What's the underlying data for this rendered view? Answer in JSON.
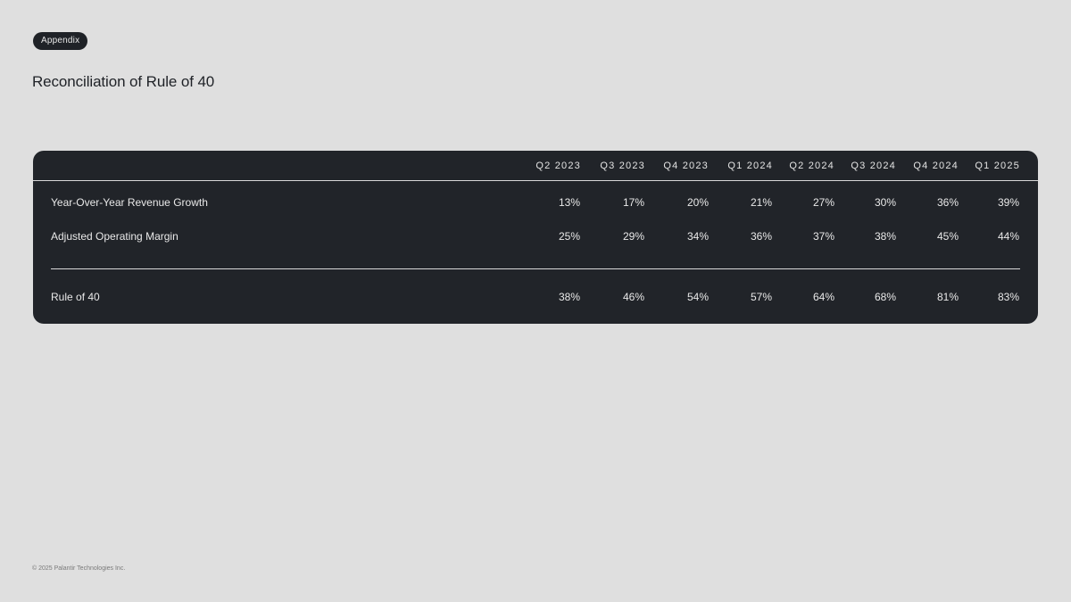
{
  "badge": "Appendix",
  "title": "Reconciliation of Rule of 40",
  "table": {
    "columns": [
      "Q2 2023",
      "Q3 2023",
      "Q4 2023",
      "Q1 2024",
      "Q2 2024",
      "Q3 2024",
      "Q4 2024",
      "Q1 2025"
    ],
    "rows": [
      {
        "label": "Year-Over-Year Revenue Growth",
        "values": [
          "13%",
          "17%",
          "20%",
          "21%",
          "27%",
          "30%",
          "36%",
          "39%"
        ]
      },
      {
        "label": "Adjusted Operating Margin",
        "values": [
          "25%",
          "29%",
          "34%",
          "36%",
          "37%",
          "38%",
          "45%",
          "44%"
        ]
      },
      {
        "label": "Rule of 40",
        "values": [
          "38%",
          "46%",
          "54%",
          "57%",
          "64%",
          "68%",
          "81%",
          "83%"
        ]
      }
    ]
  },
  "footer": "© 2025 Palantir Technologies Inc."
}
